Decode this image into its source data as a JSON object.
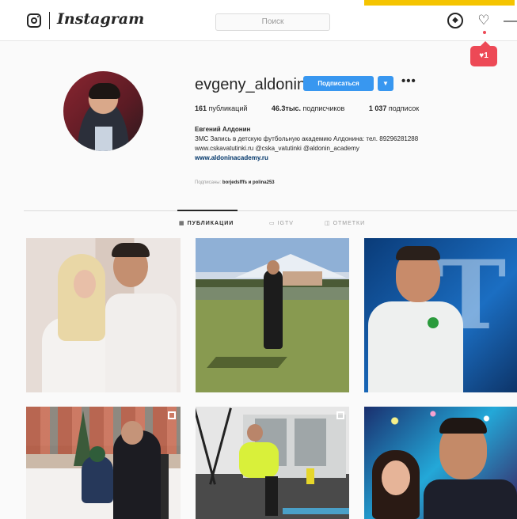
{
  "app": {
    "name": "Instagram"
  },
  "search": {
    "placeholder": "Поиск"
  },
  "nav": {
    "compass_icon": "compass-icon",
    "heart_icon": "heart-icon",
    "more_icon": "more-icon"
  },
  "notification": {
    "label": "♥1"
  },
  "profile": {
    "username": "evgeny_aldonin",
    "follow_label": "Подписаться",
    "more_label": "•••",
    "stats": {
      "posts_count": "161",
      "posts_label": " публикаций",
      "followers_count": "46.3тыс.",
      "followers_label": " подписчиков",
      "following_count": "1 037",
      "following_label": " подписок"
    },
    "bio": {
      "full_name": "Евгений Алдонин",
      "line1": "ЗМС Запись в детскую футбольную академию Алдонина: тел. 89296281288",
      "line2": "www.cskavatutinki.ru @cska_vatutinki @aldonin_academy",
      "website": "www.aldoninacademy.ru"
    },
    "followed_by": {
      "prefix": "Подписаны: ",
      "names": "borjedsfffs и polina253"
    }
  },
  "tabs": [
    {
      "label": "ПУБЛИКАЦИИ",
      "active": true
    },
    {
      "label": "IGTV",
      "active": false
    },
    {
      "label": "ОТМЕТКИ",
      "active": false
    }
  ],
  "colors": {
    "accent": "#3897f0",
    "notif": "#ed4956",
    "banner": "#f5c400"
  }
}
